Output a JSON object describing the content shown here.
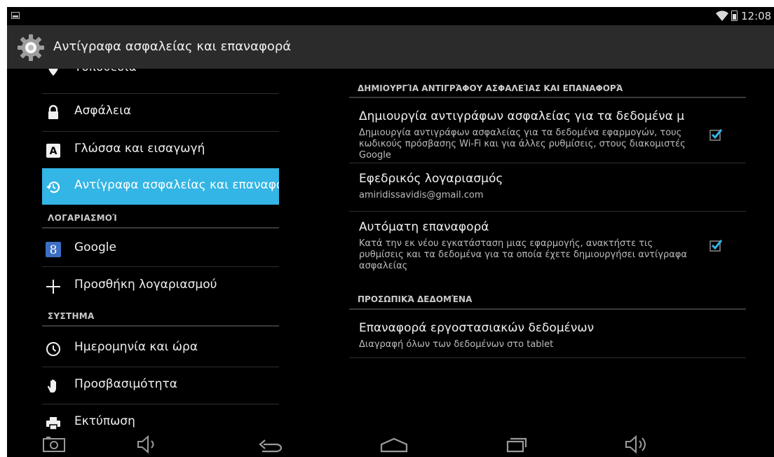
{
  "status_bar": {
    "time": "12:08"
  },
  "action_bar": {
    "title": "Αντίγραφα ασφαλείας και επαναφορά"
  },
  "left_pane": {
    "partial_item": "Τοποθεσία",
    "items_top": [
      {
        "label": "Ασφάλεια",
        "icon": "lock-icon"
      },
      {
        "label": "Γλώσσα και εισαγωγή",
        "icon": "language-icon"
      },
      {
        "label": "Αντίγραφα ασφαλείας και επαναφορά",
        "icon": "backup-restore-icon",
        "selected": true
      }
    ],
    "accounts_header": "ΛΟΓΑΡΙΑΣΜΟΊ",
    "accounts": [
      {
        "label": "Google",
        "icon": "google-icon"
      },
      {
        "label": "Προσθήκη λογαριασμού",
        "icon": "plus-icon"
      }
    ],
    "system_header": "ΣΥΣΤΗΜΑ",
    "system": [
      {
        "label": "Ημερομηνία και ώρα",
        "icon": "clock-icon"
      },
      {
        "label": "Προσβασιμότητα",
        "icon": "hand-icon"
      },
      {
        "label": "Εκτύπωση",
        "icon": "printer-icon"
      }
    ]
  },
  "right_pane": {
    "backup_header": "ΔΗΜΙΟΥΡΓΊΑ ΑΝΤΙΓΡΆΦΟΥ ΑΣΦΑΛΕΊΑΣ ΚΑΙ ΕΠΑΝΑΦΟΡΆ",
    "backup_data": {
      "title": "Δημιουργία αντιγράφων ασφαλείας για τα δεδομένα μ",
      "summary": "Δημιουργία αντιγράφων ασφαλείας για τα δεδομένα εφαρμογών, τους κωδικούς πρόσβασης Wi-Fi και για άλλες ρυθμίσεις, στους διακομιστές Google",
      "checked": true
    },
    "backup_account": {
      "title": "Εφεδρικός λογαριασμός",
      "summary": "amiridissavidis@gmail.com"
    },
    "auto_restore": {
      "title": "Αυτόματη επαναφορά",
      "summary": "Κατά την εκ νέου εγκατάσταση μιας εφαρμογής, ανακτήστε τις ρυθμίσεις και τα δεδομένα για τα οποία έχετε δημιουργήσει αντίγραφα ασφαλείας",
      "checked": true
    },
    "personal_header": "ΠΡΟΣΩΠΙΚΆ ΔΕΔΟΜΈΝΑ",
    "factory_reset": {
      "title": "Επαναφορά εργοστασιακών δεδομένων",
      "summary": "Διαγραφή όλων των δεδομένων στο tablet"
    }
  },
  "colors": {
    "accent": "#33b5e5",
    "background": "#000000",
    "action_bar": "#2b2b2b"
  }
}
